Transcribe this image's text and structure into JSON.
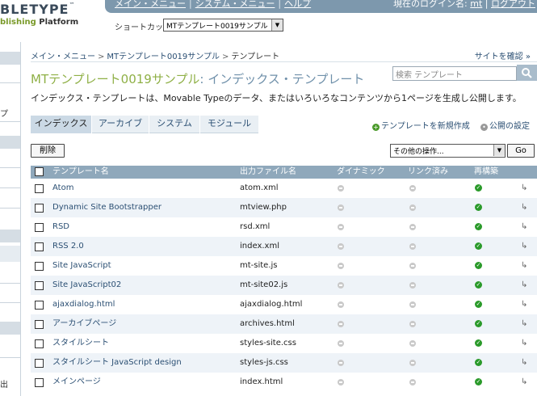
{
  "header": {
    "logo_text": "BLETYPE",
    "logo_tm": "™",
    "logo_sub_prefix": "blishing",
    "logo_sub_suffix": "Platform",
    "nav": [
      "メイン・メニュー",
      "システム・メニュー",
      "ヘルプ"
    ],
    "login_label": "現在のログイン名:",
    "login_user": "mt",
    "logout_label": "ログアウト",
    "shortcut_label": "ショートカット:",
    "shortcut_value": "MTテンプレート0019サンプル"
  },
  "sidebar": {
    "chars": [
      "プ",
      "出"
    ]
  },
  "breadcrumb": {
    "items": [
      "メイン・メニュー",
      "MTテンプレート0019サンプル",
      "テンプレート"
    ],
    "sep": ">"
  },
  "view_site": "サイトを確認",
  "page": {
    "title_main": "MTテンプレート0019サンプル",
    "title_sub": ": インデックス・テンプレート",
    "description": "インデックス・テンプレートは、Movable Typeのデータ、またはいろいろなコンテンツから1ページを生成し公開します。",
    "search_placeholder": "検索 テンプレート"
  },
  "tabs": [
    {
      "label": "インデックス",
      "active": true
    },
    {
      "label": "アーカイブ",
      "active": false
    },
    {
      "label": "システム",
      "active": false
    },
    {
      "label": "モジュール",
      "active": false
    }
  ],
  "actions": {
    "create_new": "テンプレートを新規作成",
    "publish_settings": "公開の設定",
    "delete_label": "削除",
    "more_actions": "その他の操作...",
    "go_label": "Go"
  },
  "table": {
    "headers": [
      "テンプレート名",
      "出力ファイル名",
      "ダイナミック",
      "リンク済み",
      "再構築"
    ],
    "rows": [
      {
        "name": "Atom",
        "output": "atom.xml"
      },
      {
        "name": "Dynamic Site Bootstrapper",
        "output": "mtview.php"
      },
      {
        "name": "RSD",
        "output": "rsd.xml"
      },
      {
        "name": "RSS 2.0",
        "output": "index.xml"
      },
      {
        "name": "Site JavaScript",
        "output": "mt-site.js"
      },
      {
        "name": "Site JavaScript02",
        "output": "mt-site02.js"
      },
      {
        "name": "ajaxdialog.html",
        "output": "ajaxdialog.html"
      },
      {
        "name": "アーカイブページ",
        "output": "archives.html"
      },
      {
        "name": "スタイルシート",
        "output": "styles-site.css"
      },
      {
        "name": "スタイルシート JavaScript design",
        "output": "styles-js.css"
      },
      {
        "name": "メインページ",
        "output": "index.html"
      }
    ]
  },
  "colors": {
    "accent_green": "#8fb046",
    "link_blue": "#2b4f73",
    "header_bar": "#7d98ad",
    "table_head": "#8fa8bb"
  }
}
